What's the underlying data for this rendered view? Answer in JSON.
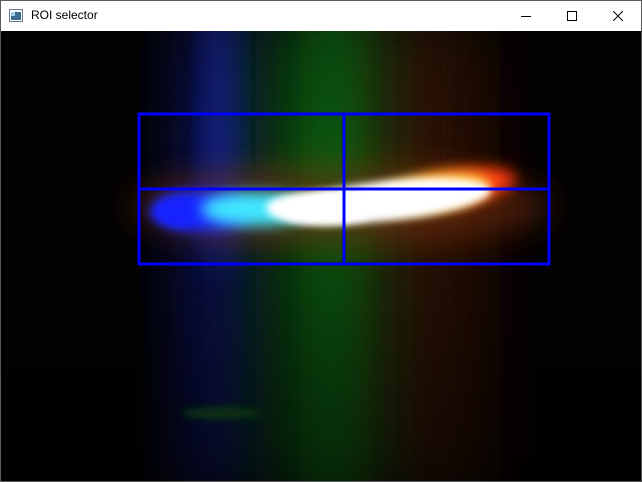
{
  "window": {
    "title": "ROI selector",
    "controls": {
      "minimize_icon": "minimize-icon",
      "maximize_icon": "maximize-icon",
      "close_icon": "close-icon"
    }
  },
  "roi": {
    "grid_rows": 2,
    "grid_cols": 2,
    "line_color": "#0000ff"
  },
  "scene": {
    "description_colors": {
      "blue": "#1a2bff",
      "cyan": "#3fe6ff",
      "white": "#ffffff",
      "yellow": "#ffd23a",
      "red": "#ff3a10",
      "green_band": "#0f6a12"
    }
  }
}
